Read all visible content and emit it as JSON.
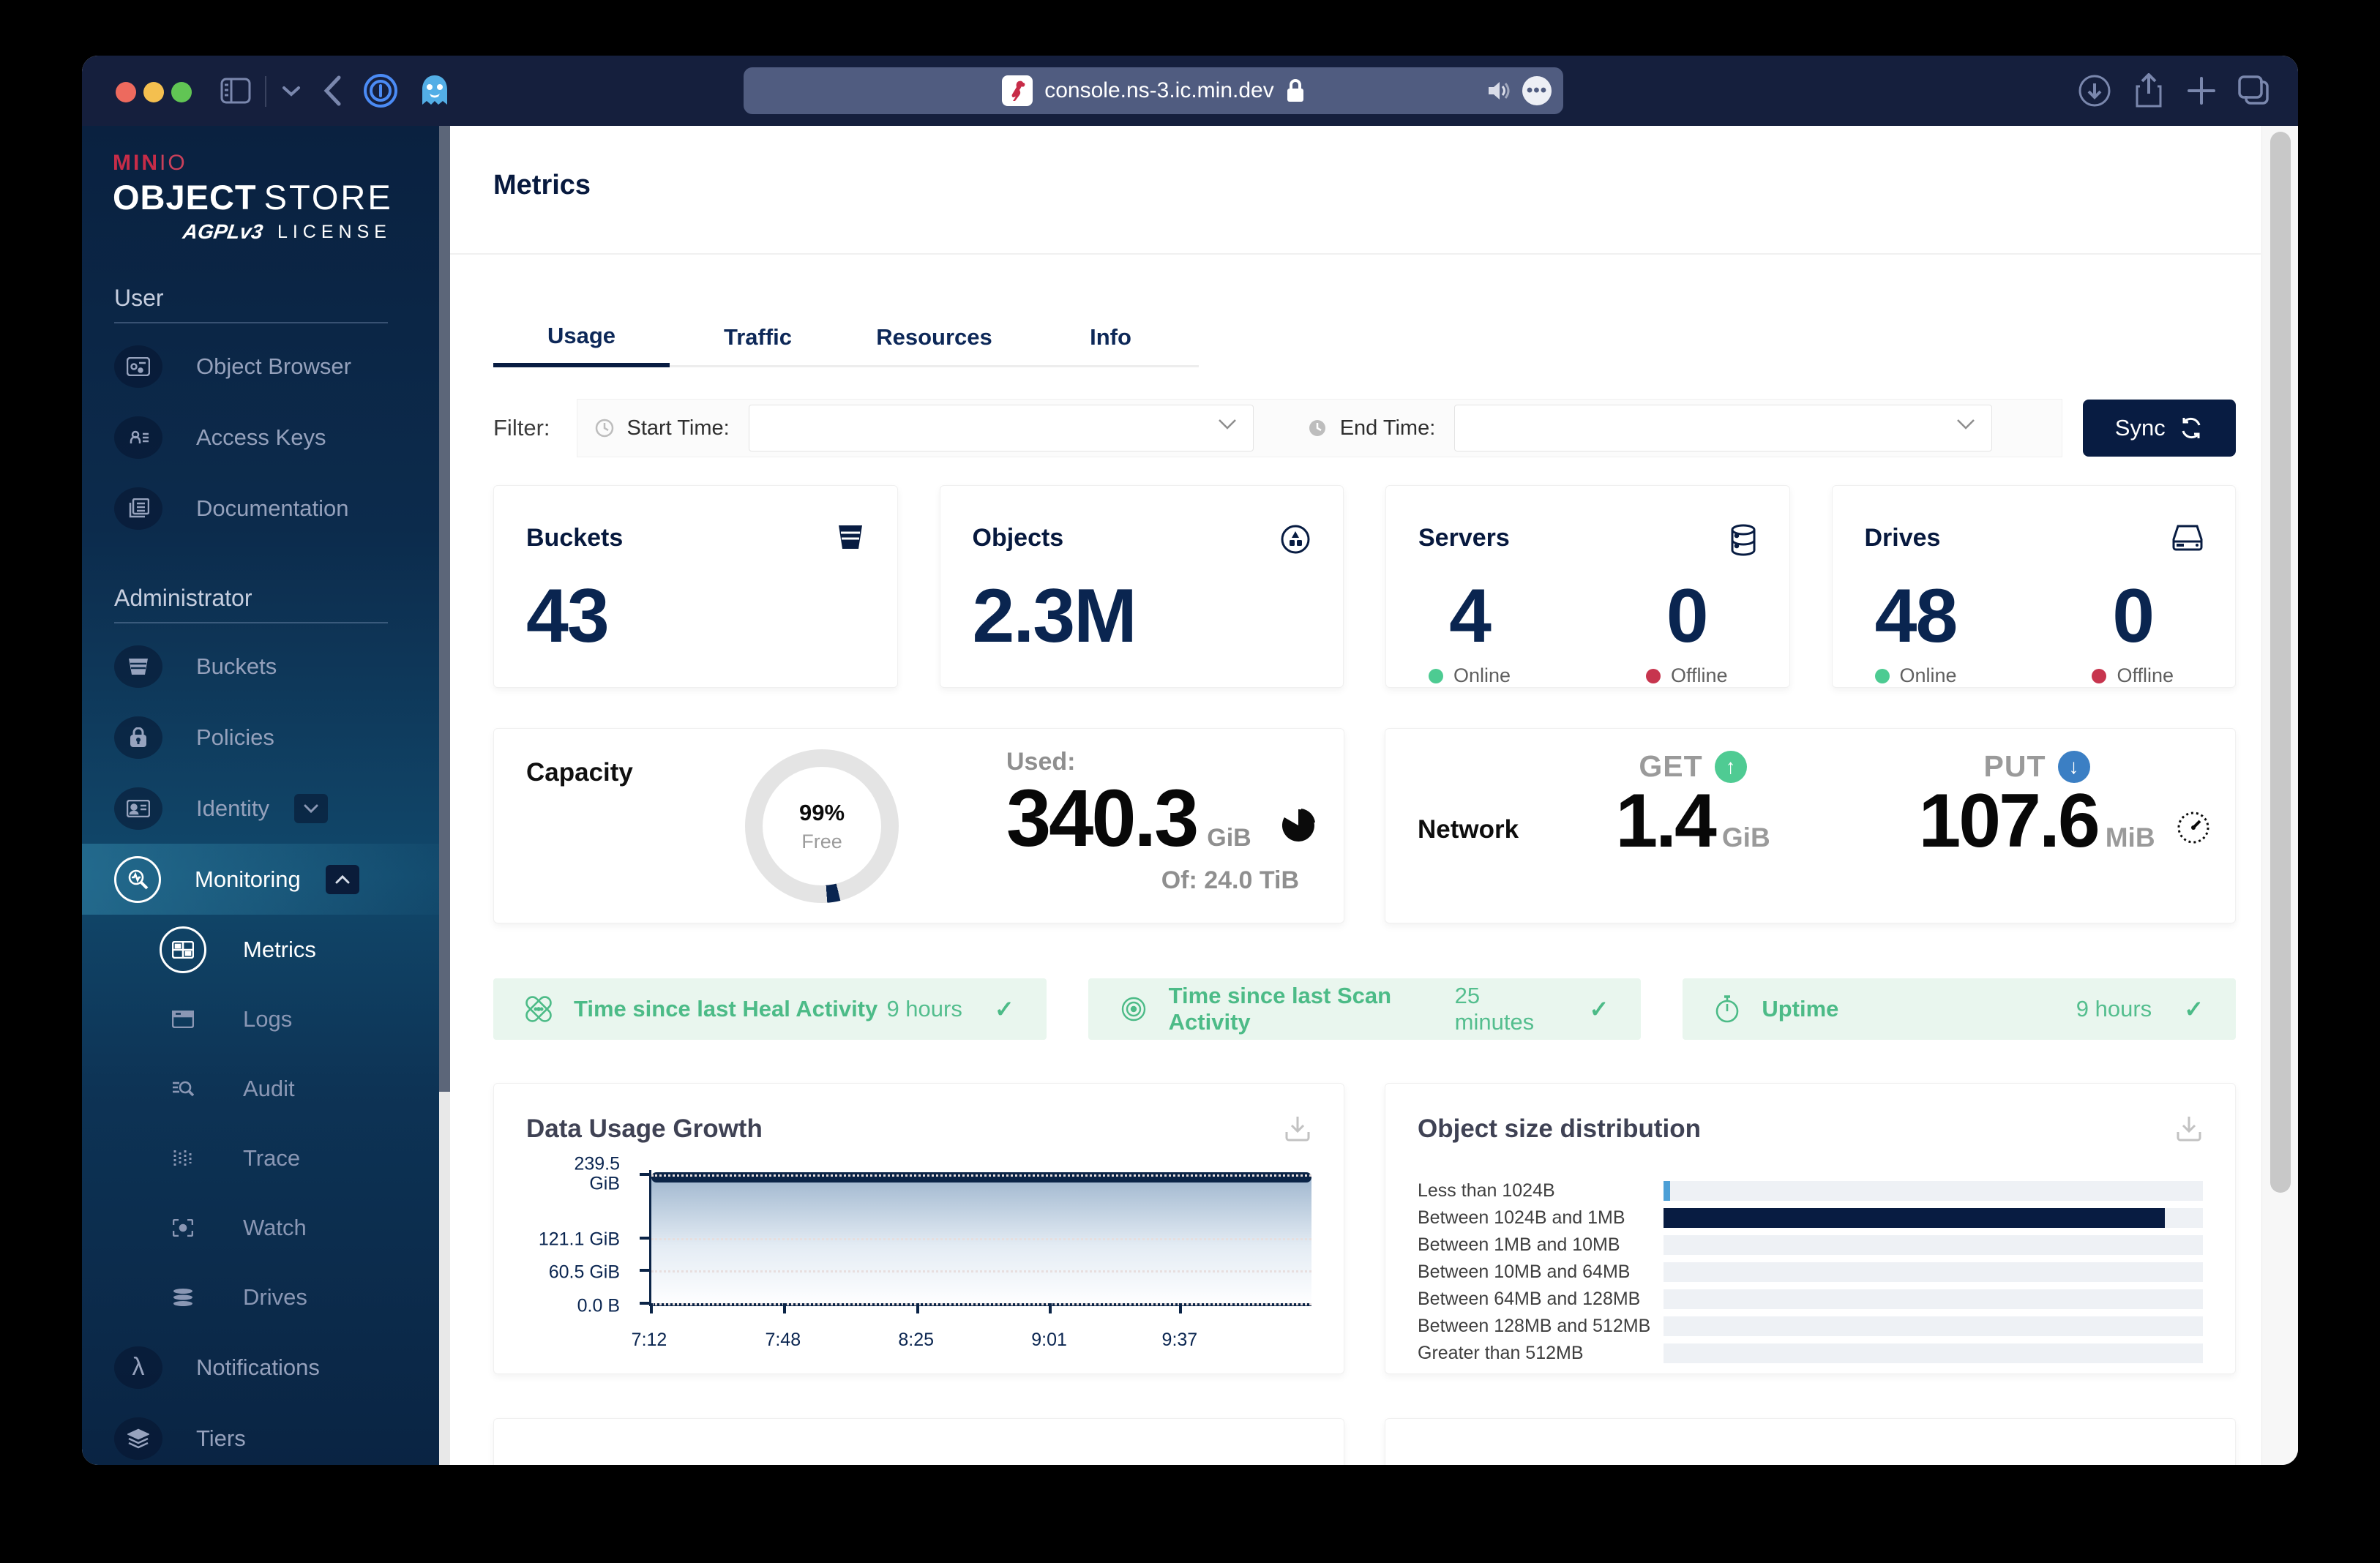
{
  "browser": {
    "url": "console.ns-3.ic.min.dev"
  },
  "icons": {
    "check": "✓"
  },
  "sidebar": {
    "logo": {
      "brand_min": "MIN",
      "brand_io": "IO",
      "product_bold": "OBJECT",
      "product_light": "STORE",
      "license_badge": "AGPLv3",
      "license_label": "LICENSE"
    },
    "user_section": {
      "header": "User",
      "items": [
        {
          "label": "Object Browser"
        },
        {
          "label": "Access Keys"
        },
        {
          "label": "Documentation"
        }
      ]
    },
    "admin_section": {
      "header": "Administrator",
      "items": [
        {
          "label": "Buckets"
        },
        {
          "label": "Policies"
        },
        {
          "label": "Identity"
        },
        {
          "label": "Monitoring"
        }
      ]
    },
    "monitoring_children": [
      {
        "label": "Metrics",
        "active": true
      },
      {
        "label": "Logs"
      },
      {
        "label": "Audit"
      },
      {
        "label": "Trace"
      },
      {
        "label": "Watch"
      },
      {
        "label": "Drives"
      }
    ],
    "bottom_items": [
      {
        "label": "Notifications"
      },
      {
        "label": "Tiers"
      }
    ]
  },
  "main": {
    "title": "Metrics",
    "tabs": [
      {
        "label": "Usage",
        "active": true
      },
      {
        "label": "Traffic"
      },
      {
        "label": "Resources"
      },
      {
        "label": "Info"
      }
    ],
    "filter": {
      "label": "Filter:",
      "start_label": "Start Time:",
      "end_label": "End Time:",
      "start_value": "",
      "end_value": "",
      "sync_label": "Sync"
    },
    "cards": {
      "buckets": {
        "title": "Buckets",
        "value": "43"
      },
      "objects": {
        "title": "Objects",
        "value": "2.3M"
      },
      "servers": {
        "title": "Servers",
        "online": "4",
        "offline": "0",
        "online_label": "Online",
        "offline_label": "Offline"
      },
      "drives": {
        "title": "Drives",
        "online": "48",
        "offline": "0",
        "online_label": "Online",
        "offline_label": "Offline"
      }
    },
    "capacity": {
      "title": "Capacity",
      "free_percent": "99%",
      "free_label": "Free",
      "used_label": "Used:",
      "used_value": "340.3",
      "used_unit": "GiB",
      "total_label": "Of: 24.0 TiB"
    },
    "network": {
      "title": "Network",
      "get_label": "GET",
      "get_value": "1.4",
      "get_unit": "GiB",
      "put_label": "PUT",
      "put_value": "107.6",
      "put_unit": "MiB"
    },
    "banners": [
      {
        "label": "Time since last Heal Activity",
        "value": "9 hours"
      },
      {
        "label": "Time since last Scan Activity",
        "value": "25 minutes"
      },
      {
        "label": "Uptime",
        "value": "9 hours"
      }
    ]
  },
  "chart_data": [
    {
      "type": "area",
      "title": "Data Usage Growth",
      "x": [
        "7:12",
        "7:48",
        "8:25",
        "9:01",
        "9:37"
      ],
      "xtick_pos_percent": [
        0,
        20.2,
        40.3,
        60.4,
        80.1
      ],
      "series": [
        {
          "name": "Data Usage",
          "values": [
            235.4,
            235.4,
            235.4,
            235.4,
            235.4
          ]
        }
      ],
      "ylim": [
        0,
        247
      ],
      "yticks": [
        239.5,
        121.1,
        60.5,
        0
      ],
      "ytick_labels": [
        "239.5\nGiB",
        "121.1 GiB",
        "60.5 GiB",
        "0.0 B"
      ],
      "grid": "dotted-horizontal",
      "line_color": "#0B2447",
      "fill": "blue-gradient"
    },
    {
      "type": "bar",
      "title": "Object size distribution",
      "orientation": "horizontal",
      "categories": [
        "Less than 1024B",
        "Between 1024B and 1MB",
        "Between 1MB and 10MB",
        "Between 10MB and 64MB",
        "Between 64MB and 128MB",
        "Between 128MB and 512MB",
        "Greater than 512MB"
      ],
      "values_percent": [
        1.2,
        93,
        0,
        0,
        0,
        0,
        0
      ],
      "bar_colors": [
        "#4C9FD6",
        "#081C42",
        "",
        "",
        "",
        "",
        ""
      ]
    }
  ],
  "colors": {
    "brand_red": "#C72C48",
    "navy": "#081C42",
    "green": "#4CBB87",
    "status_online": "#4DCB92",
    "status_offline": "#C7354E",
    "banner_bg": "#E9F6EE",
    "put_blue": "#3B7FC4",
    "chrome_navy": "#151F3D"
  }
}
